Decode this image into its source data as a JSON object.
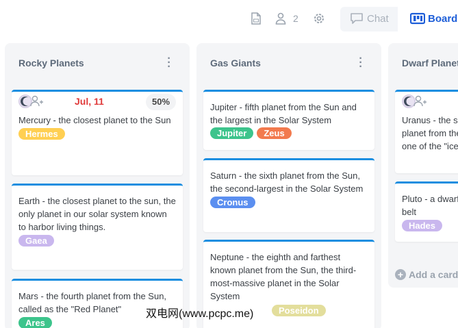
{
  "toolbar": {
    "icons": [
      "file-icon",
      "user-icon",
      "gear-icon",
      "chat-bubble-icon",
      "board-icon"
    ],
    "member_count": "2",
    "chat_label": "Chat",
    "board_label": "Board"
  },
  "columns": [
    {
      "title": "Rocky Planets",
      "cards": [
        {
          "text": "Mercury - the closest planet to the Sun",
          "due": "Jul, 11",
          "progress": "50%",
          "tags": [
            {
              "label": "Hermes",
              "color": "#ffcf52"
            }
          ]
        },
        {
          "text": "Earth - the closest planet to the sun, the only planet in our solar system known to harbor living things.",
          "tags": [
            {
              "label": "Gaea",
              "color": "#c9b7ee"
            }
          ]
        },
        {
          "text": "Mars - the fourth planet from the Sun, called as the \"Red Planet\"",
          "tags": [
            {
              "label": "Ares",
              "color": "#3dc48c"
            }
          ]
        }
      ]
    },
    {
      "title": "Gas Giants",
      "cards": [
        {
          "text": "Jupiter - fifth planet from the Sun and the largest in the Solar System",
          "tags": [
            {
              "label": "Jupiter",
              "color": "#3dc48c"
            },
            {
              "label": "Zeus",
              "color": "#f27a4e"
            }
          ]
        },
        {
          "text": "Saturn - the sixth planet from the Sun, the second-largest in the Solar System",
          "tags": [
            {
              "label": "Cronus",
              "color": "#5b8ff0"
            }
          ]
        },
        {
          "text": "Neptune - the eighth and farthest known planet from the Sun, the third-most-massive planet in the Solar System",
          "tags": [
            {
              "label": "Poseidon",
              "color": "#e3de9c"
            }
          ]
        }
      ]
    },
    {
      "title": "Dwarf Planets",
      "cards": [
        {
          "text": "Uranus - the seventh planet from the Sun, it is one of the \"ice giants\""
        },
        {
          "text": "Pluto - a dwarf planet in the Kuiper belt",
          "tags": [
            {
              "label": "Hades",
              "color": "#c9b7ee"
            }
          ]
        }
      ],
      "add_card_label": "Add a card"
    }
  ],
  "watermark": "双电网(www.pcpc.me)"
}
